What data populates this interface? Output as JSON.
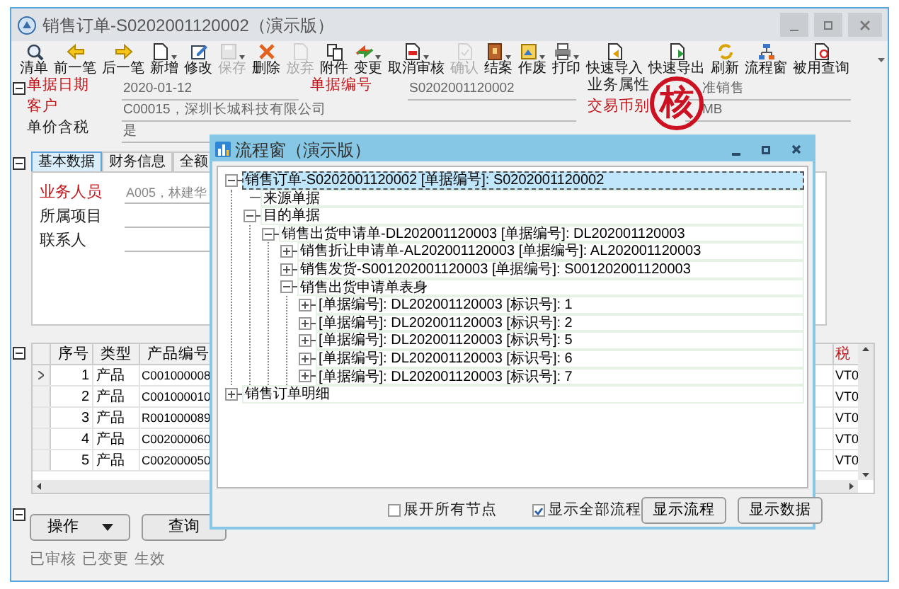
{
  "window": {
    "title": "销售订单-S0202001120002（演示版）"
  },
  "toolbar": [
    {
      "label": "清单",
      "disabled": false,
      "dropdown": false
    },
    {
      "label": "前一笔",
      "disabled": false,
      "dropdown": false
    },
    {
      "label": "后一笔",
      "disabled": false,
      "dropdown": false
    },
    {
      "label": "新增",
      "disabled": false,
      "dropdown": true
    },
    {
      "label": "修改",
      "disabled": false,
      "dropdown": false
    },
    {
      "label": "保存",
      "disabled": true,
      "dropdown": true
    },
    {
      "label": "删除",
      "disabled": false,
      "dropdown": false
    },
    {
      "label": "放弃",
      "disabled": true,
      "dropdown": false
    },
    {
      "label": "附件",
      "disabled": false,
      "dropdown": false
    },
    {
      "label": "变更",
      "disabled": false,
      "dropdown": true
    },
    {
      "label": "取消审核",
      "disabled": false,
      "dropdown": true
    },
    {
      "label": "确认",
      "disabled": true,
      "dropdown": false
    },
    {
      "label": "结案",
      "disabled": false,
      "dropdown": true
    },
    {
      "label": "作废",
      "disabled": false,
      "dropdown": true
    },
    {
      "label": "打印",
      "disabled": false,
      "dropdown": true
    },
    {
      "label": "快速导入",
      "disabled": false,
      "dropdown": false
    },
    {
      "label": "快速导出",
      "disabled": false,
      "dropdown": false
    },
    {
      "label": "刷新",
      "disabled": false,
      "dropdown": false
    },
    {
      "label": "流程窗",
      "disabled": false,
      "dropdown": false
    },
    {
      "label": "被用查询",
      "disabled": false,
      "dropdown": false
    }
  ],
  "header_fields": [
    [
      {
        "label": "单据日期",
        "required": true,
        "value": "2020-01-12"
      },
      {
        "label": "单据编号",
        "required": true,
        "value": "S0202001120002"
      },
      {
        "label": "业务属性",
        "required": false,
        "value": "准销售"
      }
    ],
    [
      {
        "label": "客户",
        "required": true,
        "value": "C00015，深圳长城科技有限公司"
      },
      {
        "label": "交易币别",
        "required": true,
        "value": "MB"
      }
    ],
    [
      {
        "label": "单价含税",
        "required": false,
        "value": "是"
      }
    ]
  ],
  "stamp": "核",
  "tabs": [
    {
      "label": "基本数据",
      "selected": true
    },
    {
      "label": "财务信息",
      "selected": false
    },
    {
      "label": "全额",
      "selected": false
    }
  ],
  "tab_fields": [
    {
      "label": "业务人员",
      "required": true,
      "value": "A005，林建华"
    },
    {
      "label": "所属项目",
      "required": false
    },
    {
      "label": "联系人",
      "required": false
    }
  ],
  "grid": {
    "columns": [
      "序号",
      "类型",
      "产品编号"
    ],
    "right_column": "税",
    "rows": [
      {
        "no": "1",
        "type": "产品",
        "code": "C001000008",
        "right": "VT0",
        "selected": true
      },
      {
        "no": "2",
        "type": "产品",
        "code": "C001000010",
        "right": "VT0",
        "selected": false
      },
      {
        "no": "3",
        "type": "产品",
        "code": "R001000089",
        "right": "VT0",
        "selected": false
      },
      {
        "no": "4",
        "type": "产品",
        "code": "C002000060",
        "right": "VT0",
        "selected": false
      },
      {
        "no": "5",
        "type": "产品",
        "code": "C002000050",
        "right": "VT0",
        "selected": false
      }
    ]
  },
  "actions": [
    {
      "label": "操作",
      "dropdown": true
    },
    {
      "label": "查询",
      "dropdown": false
    }
  ],
  "status": [
    "已审核",
    "已变更",
    "生效"
  ],
  "dialog": {
    "title": "流程窗（演示版）",
    "tree": [
      {
        "text": "销售订单-S0202001120002  [单据编号]: S0202001120002",
        "kind": "branch",
        "expanded": true,
        "selected": true,
        "children": [
          {
            "text": "来源单据",
            "kind": "leaf",
            "selected": false
          },
          {
            "text": "目的单据",
            "kind": "branch",
            "expanded": true,
            "selected": false,
            "children": [
              {
                "text": "销售出货申请单-DL202001120003  [单据编号]: DL202001120003",
                "kind": "branch",
                "expanded": true,
                "selected": false,
                "children": [
                  {
                    "text": "销售折让申请单-AL202001120003  [单据编号]: AL202001120003",
                    "kind": "branch",
                    "expanded": false,
                    "selected": false
                  },
                  {
                    "text": "销售发货-S001202001120003  [单据编号]: S001202001120003",
                    "kind": "branch",
                    "expanded": false,
                    "selected": false
                  },
                  {
                    "text": "销售出货申请单表身",
                    "kind": "branch",
                    "expanded": true,
                    "selected": false,
                    "children": [
                      {
                        "text": "[单据编号]: DL202001120003 [标识号]: 1",
                        "kind": "branch",
                        "expanded": false,
                        "selected": false
                      },
                      {
                        "text": "[单据编号]: DL202001120003 [标识号]: 2",
                        "kind": "branch",
                        "expanded": false,
                        "selected": false
                      },
                      {
                        "text": "[单据编号]: DL202001120003 [标识号]: 5",
                        "kind": "branch",
                        "expanded": false,
                        "selected": false
                      },
                      {
                        "text": "[单据编号]: DL202001120003 [标识号]: 6",
                        "kind": "branch",
                        "expanded": false,
                        "selected": false
                      },
                      {
                        "text": "[单据编号]: DL202001120003 [标识号]: 7",
                        "kind": "branch",
                        "expanded": false,
                        "selected": false
                      }
                    ]
                  }
                ]
              }
            ]
          }
        ]
      },
      {
        "text": "销售订单明细",
        "kind": "branch",
        "expanded": false,
        "selected": false
      }
    ],
    "options": [
      {
        "label": "展开所有节点",
        "checked": false
      },
      {
        "label": "显示全部流程",
        "checked": true
      }
    ],
    "buttons": [
      "显示流程",
      "显示数据"
    ]
  }
}
